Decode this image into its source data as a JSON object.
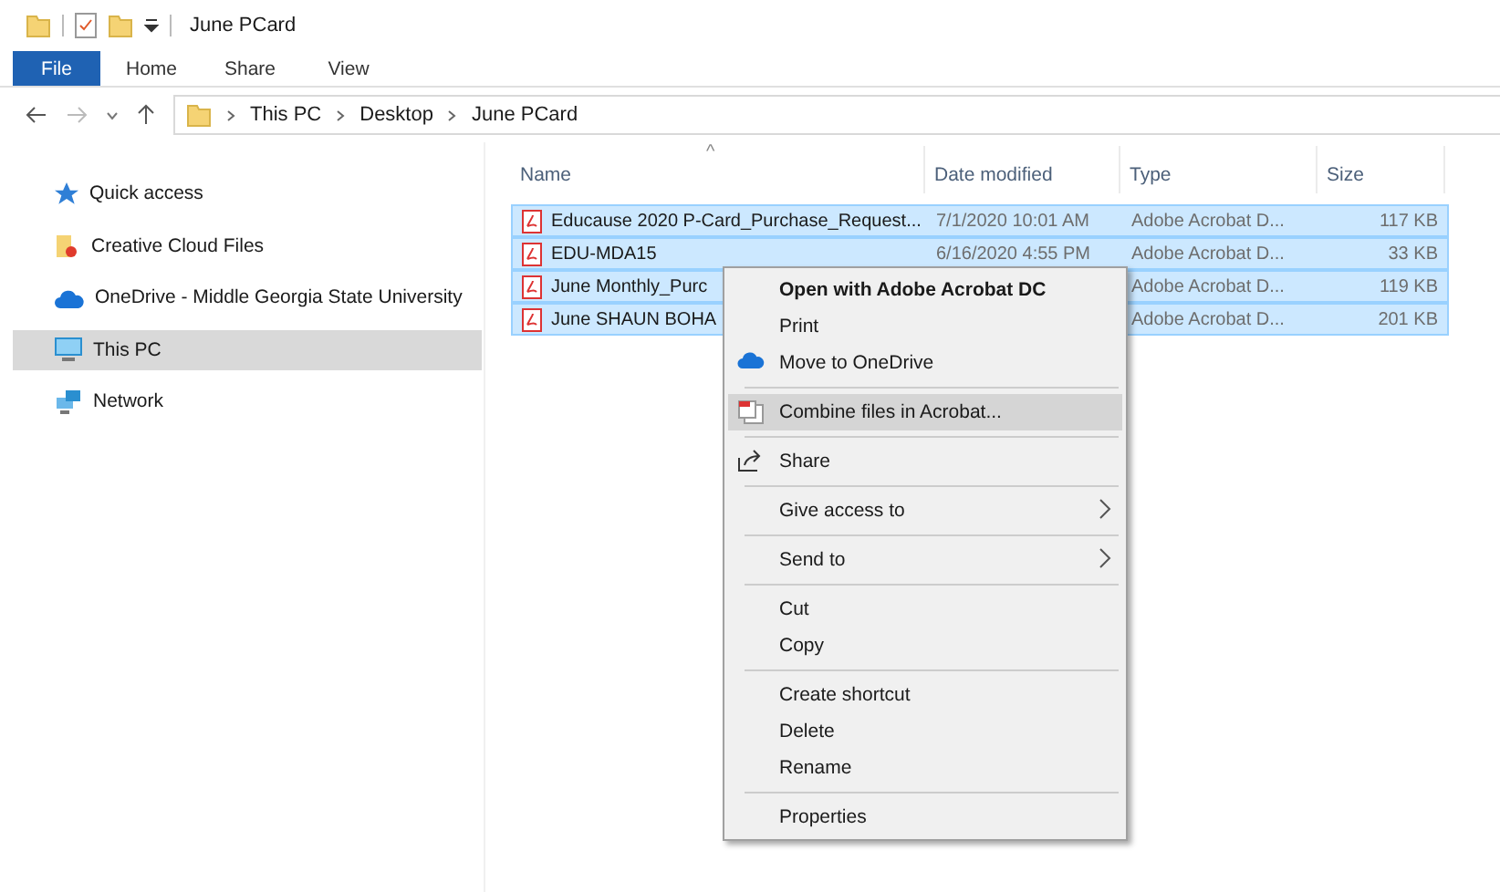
{
  "window": {
    "title": "June PCard"
  },
  "ribbon_tabs": [
    {
      "label": "File",
      "selected": true
    },
    {
      "label": "Home",
      "selected": false
    },
    {
      "label": "Share",
      "selected": false
    },
    {
      "label": "View",
      "selected": false
    }
  ],
  "address_bar": {
    "path": [
      "This PC",
      "Desktop",
      "June PCard"
    ]
  },
  "sidebar": {
    "items": [
      {
        "label": "Quick access",
        "selected": false
      },
      {
        "label": "Creative Cloud Files",
        "selected": false
      },
      {
        "label": "OneDrive - Middle Georgia State University",
        "selected": false
      },
      {
        "label": "This PC",
        "selected": true
      },
      {
        "label": "Network",
        "selected": false
      }
    ]
  },
  "table": {
    "sort_arrow": "^",
    "columns": [
      "Name",
      "Date modified",
      "Type",
      "Size"
    ],
    "rows": [
      {
        "name": "Educause 2020 P-Card_Purchase_Request...",
        "date": "7/1/2020 10:01 AM",
        "type": "Adobe Acrobat D...",
        "size": "117 KB",
        "selected": true
      },
      {
        "name": "EDU-MDA15",
        "date": "6/16/2020 4:55 PM",
        "type": "Adobe Acrobat D...",
        "size": "33 KB",
        "selected": true
      },
      {
        "name": "June Monthly_Purc",
        "type": "Adobe Acrobat D...",
        "size": "119 KB",
        "selected": true
      },
      {
        "name": "June SHAUN BOHA",
        "type": "Adobe Acrobat D...",
        "size": "201 KB",
        "selected": true
      }
    ]
  },
  "context_menu": {
    "groups": [
      [
        {
          "label": "Open with Adobe Acrobat DC",
          "bold": true,
          "selected": false,
          "submenu": false
        },
        {
          "label": "Print",
          "bold": false,
          "selected": false,
          "submenu": false
        },
        {
          "label": "Move to OneDrive",
          "bold": false,
          "selected": false,
          "submenu": false
        }
      ],
      [
        {
          "label": "Combine files in Acrobat...",
          "bold": false,
          "selected": true,
          "submenu": false
        }
      ],
      [
        {
          "label": "Share",
          "bold": false,
          "selected": false,
          "submenu": false
        }
      ],
      [
        {
          "label": "Give access to",
          "bold": false,
          "selected": false,
          "submenu": true
        }
      ],
      [
        {
          "label": "Send to",
          "bold": false,
          "selected": false,
          "submenu": true
        }
      ],
      [
        {
          "label": "Cut",
          "bold": false,
          "selected": false,
          "submenu": false
        },
        {
          "label": "Copy",
          "bold": false,
          "selected": false,
          "submenu": false
        }
      ],
      [
        {
          "label": "Create shortcut",
          "bold": false,
          "selected": false,
          "submenu": false
        },
        {
          "label": "Delete",
          "bold": false,
          "selected": false,
          "submenu": false
        },
        {
          "label": "Rename",
          "bold": false,
          "selected": false,
          "submenu": false
        }
      ],
      [
        {
          "label": "Properties",
          "bold": false,
          "selected": false,
          "submenu": false
        }
      ]
    ]
  }
}
